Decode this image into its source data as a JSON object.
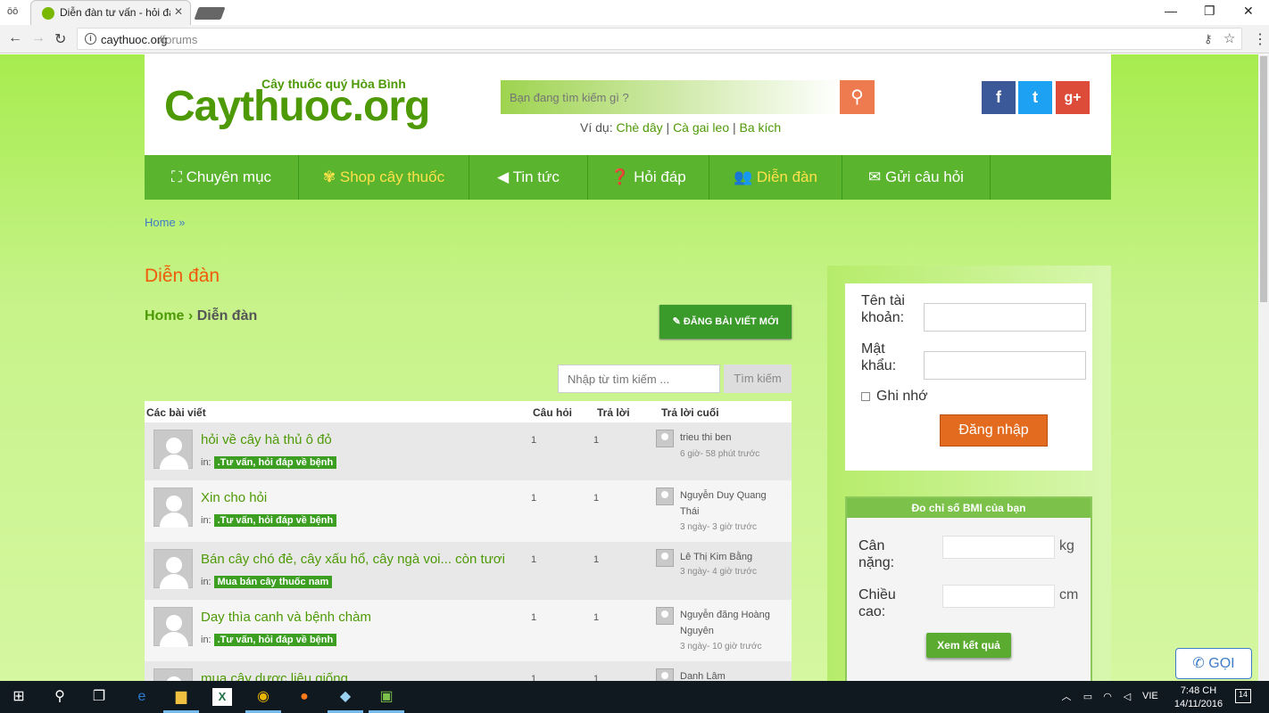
{
  "browser": {
    "tab_title": "Diễn đàn tư vấn - hỏi đáp",
    "url_host": "caythuoc.org",
    "url_path": "/forums"
  },
  "header": {
    "logo_tagline": "Cây thuốc quý Hòa Bình",
    "logo_text": "Caythuoc.org",
    "search_placeholder": "Bạn đang tìm kiếm gì ?",
    "examples_prefix": "Ví dụ:",
    "examples": [
      "Chè dây",
      "Cà gai leo",
      "Ba kích"
    ],
    "social": [
      "f",
      "t",
      "g+"
    ]
  },
  "nav": {
    "items": [
      {
        "label": "Chuyên mục",
        "icon": "sitemap-icon"
      },
      {
        "label": "Shop cây thuốc",
        "icon": "leaf-icon"
      },
      {
        "label": "Tin tức",
        "icon": "megaphone-icon"
      },
      {
        "label": "Hỏi đáp",
        "icon": "question-icon"
      },
      {
        "label": "Diễn đàn",
        "icon": "users-icon"
      },
      {
        "label": "Gửi câu hỏi",
        "icon": "envelope-icon"
      }
    ],
    "active": "Diễn đàn",
    "colors": {
      "bar": "#5ab42d",
      "active_text": "#ffe14a"
    }
  },
  "breadcrumb_top": "Home »",
  "page_title": "Diễn đàn",
  "breadcrumb": {
    "home": "Home",
    "sep": "›",
    "current": "Diễn đàn"
  },
  "new_post_label": "ĐĂNG BÀI VIẾT MỚI",
  "forum_search": {
    "placeholder": "Nhập từ tìm kiếm ...",
    "button": "Tìm kiếm"
  },
  "table": {
    "headers": [
      "Các bài viết",
      "Câu hỏi",
      "Trả lời",
      "Trả lời cuối"
    ],
    "in_label": "in:",
    "rows": [
      {
        "title": "hỏi về cây hà thủ ô đỏ",
        "category": ".Tư vấn, hỏi đáp về bệnh",
        "questions": "1",
        "replies": "1",
        "last_user": "trieu thi ben",
        "last_time": "6 giờ- 58 phút trước"
      },
      {
        "title": "Xin cho hỏi",
        "category": ".Tư vấn, hỏi đáp về bệnh",
        "questions": "1",
        "replies": "1",
        "last_user": "Nguyễn Duy Quang Thái",
        "last_time": "3 ngày- 3 giờ trước"
      },
      {
        "title": "Bán cây chó đẻ, cây xấu hổ, cây ngà voi... còn tươi",
        "category": "Mua bán cây thuốc nam",
        "questions": "1",
        "replies": "1",
        "last_user": "Lê Thị Kim Bằng",
        "last_time": "3 ngày- 4 giờ trước"
      },
      {
        "title": "Day thìa canh và bệnh chàm",
        "category": ".Tư vấn, hỏi đáp về bệnh",
        "questions": "1",
        "replies": "1",
        "last_user": "Nguyễn đăng Hoàng Nguyên",
        "last_time": "3 ngày- 10 giờ trước"
      },
      {
        "title": "mua cây dược liệu giống",
        "category": "",
        "questions": "1",
        "replies": "1",
        "last_user": "Danh Lâm",
        "last_time": ""
      }
    ]
  },
  "login": {
    "username_label": "Tên tài khoản:",
    "password_label": "Mật khẩu:",
    "remember_label": "Ghi nhớ",
    "login_button": "Đăng nhập"
  },
  "bmi": {
    "title": "Đo chỉ số BMI của bạn",
    "weight_label": "Cân nặng:",
    "weight_unit": "kg",
    "height_label": "Chiều cao:",
    "height_unit": "cm",
    "button": "Xem kết quả"
  },
  "call_button": "GỌI",
  "taskbar": {
    "language": "VIE",
    "time": "7:48 CH",
    "date": "14/11/2016",
    "notifications": "14"
  }
}
